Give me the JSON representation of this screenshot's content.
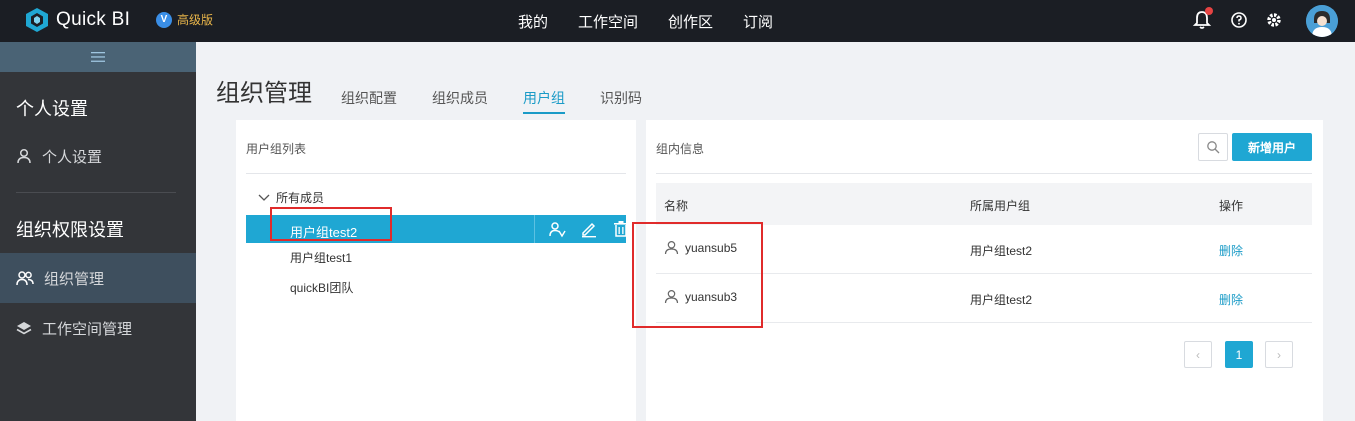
{
  "app": {
    "name": "Quick BI",
    "edition_badge": "V",
    "edition": "高级版"
  },
  "topnav": {
    "items": [
      "我的",
      "工作空间",
      "创作区",
      "订阅"
    ]
  },
  "sidebar": {
    "section1": "个人设置",
    "item_personal": "个人设置",
    "section2": "组织权限设置",
    "item_org": "组织管理",
    "item_workspace": "工作空间管理"
  },
  "page": {
    "title": "组织管理",
    "tabs": [
      "组织配置",
      "组织成员",
      "用户组",
      "识别码"
    ],
    "active_tab": "用户组"
  },
  "left_panel": {
    "title": "用户组列表",
    "root": "所有成员",
    "groups": [
      "用户组test2",
      "用户组test1",
      "quickBI团队"
    ],
    "selected": "用户组test2"
  },
  "right_panel": {
    "title": "组内信息",
    "add_button": "新增用户",
    "columns": [
      "名称",
      "所属用户组",
      "操作"
    ],
    "rows": [
      {
        "name": "yuansub5",
        "group": "用户组test2",
        "action": "删除"
      },
      {
        "name": "yuansub3",
        "group": "用户组test2",
        "action": "删除"
      }
    ],
    "pagination": {
      "prev": "‹",
      "current": "1",
      "next": "›"
    }
  },
  "colors": {
    "accent": "#1fa7d3",
    "topbar": "#1b1e24",
    "sidebar": "#333539",
    "highlight_box": "#e02b2b"
  },
  "icons": [
    "logo-icon",
    "bell-icon",
    "help-icon",
    "gear-icon",
    "user-icon",
    "group-icon",
    "layers-icon",
    "chevron-down-icon",
    "assign-user-icon",
    "edit-icon",
    "trash-icon",
    "search-icon"
  ]
}
